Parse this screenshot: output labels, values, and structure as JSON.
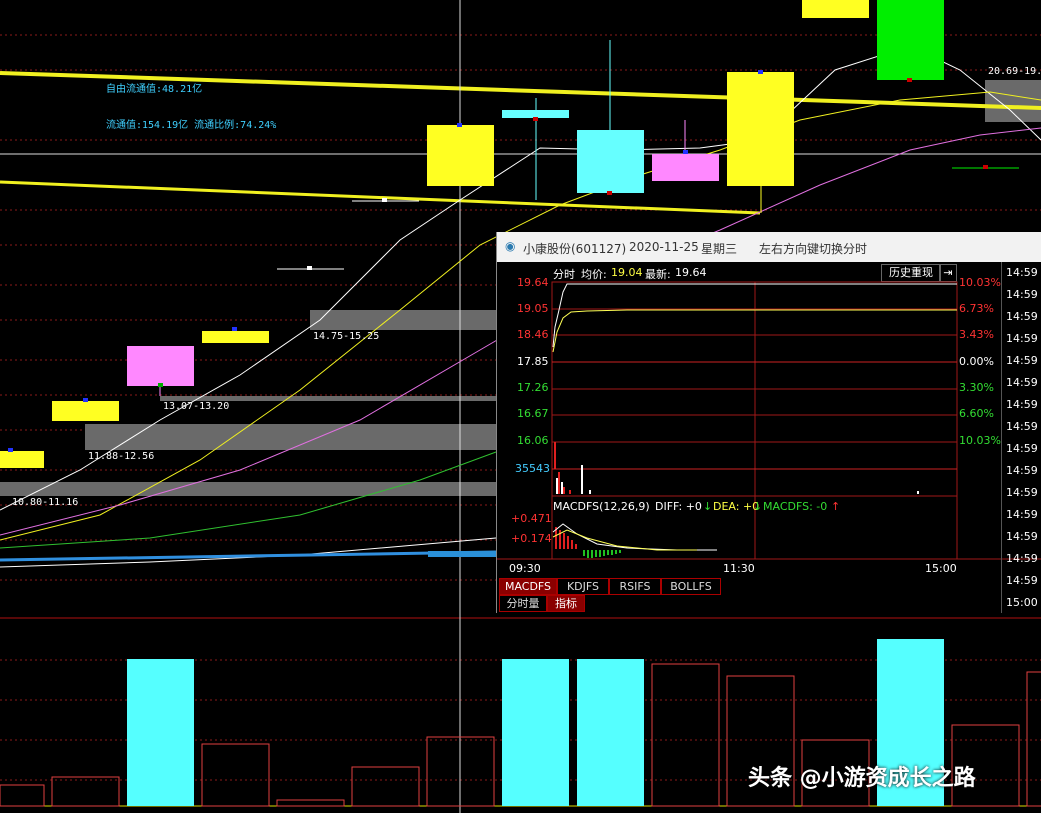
{
  "app": {
    "watermark": "头条 @小游资成长之路"
  },
  "kline": {
    "float_value_label": "自由流通值:48.21亿",
    "circulation_label": "流通值:154.19亿 流通比例:74.24%",
    "zones": [
      {
        "text": "10.80-11.16"
      },
      {
        "text": "11.88-12.56"
      },
      {
        "text": "13.07-13.20"
      },
      {
        "text": "14.75-15.25"
      },
      {
        "text": "20.69-19."
      }
    ]
  },
  "popup": {
    "stock": "小康股份(601127)",
    "date": "2020-11-25",
    "weekday": "星期三",
    "hint": "左右方向键切换分时",
    "header": {
      "mode": "分时",
      "avg_label": "均价:",
      "avg_value": "19.04",
      "last_label": "最新:",
      "last_value": "19.64",
      "history_button": "历史重现"
    },
    "price_labels": [
      "19.64",
      "19.05",
      "18.46",
      "17.85",
      "17.26",
      "16.67",
      "16.06"
    ],
    "pct_labels": [
      "10.03%",
      "6.73%",
      "3.43%",
      "0.00%",
      "3.30%",
      "6.60%",
      "10.03%"
    ],
    "volume_label": "35543",
    "macd": {
      "title": "MACDFS(12,26,9)",
      "diff_label": "DIFF: +0",
      "dea_label": "DEA: +0",
      "macdfs_label": "MACDFS: -0",
      "upper": "+0.471",
      "lower": "+0.174"
    },
    "time_labels": [
      "09:30",
      "11:30",
      "15:00"
    ],
    "indicator_tabs": [
      {
        "label": "MACDFS",
        "active": true
      },
      {
        "label": "KDJFS",
        "active": false
      },
      {
        "label": "RSIFS",
        "active": false
      },
      {
        "label": "BOLLFS",
        "active": false
      }
    ],
    "bottom_tabs": [
      {
        "label": "分时量",
        "active": false
      },
      {
        "label": "指标",
        "active": true
      }
    ],
    "tick_times": [
      "14:59",
      "14:59",
      "14:59",
      "14:59",
      "14:59",
      "14:59",
      "14:59",
      "14:59",
      "14:59",
      "14:59",
      "14:59",
      "14:59",
      "14:59",
      "14:59",
      "14:59",
      "14:59",
      "15:00"
    ]
  },
  "chart_data": {
    "type": "table",
    "candles": [
      {
        "label": "10.80-11.16",
        "color": "yellow"
      },
      {
        "label": "11.88-12.56",
        "color": "yellow"
      },
      {
        "label": "13.07-13.20",
        "color": "magenta"
      },
      {
        "label": "14.75-15.25",
        "color": "yellow"
      }
    ],
    "intraday": {
      "open_ref": 17.85,
      "last": 19.64,
      "avg": 19.04,
      "high_limit_pct": 10.03
    }
  }
}
